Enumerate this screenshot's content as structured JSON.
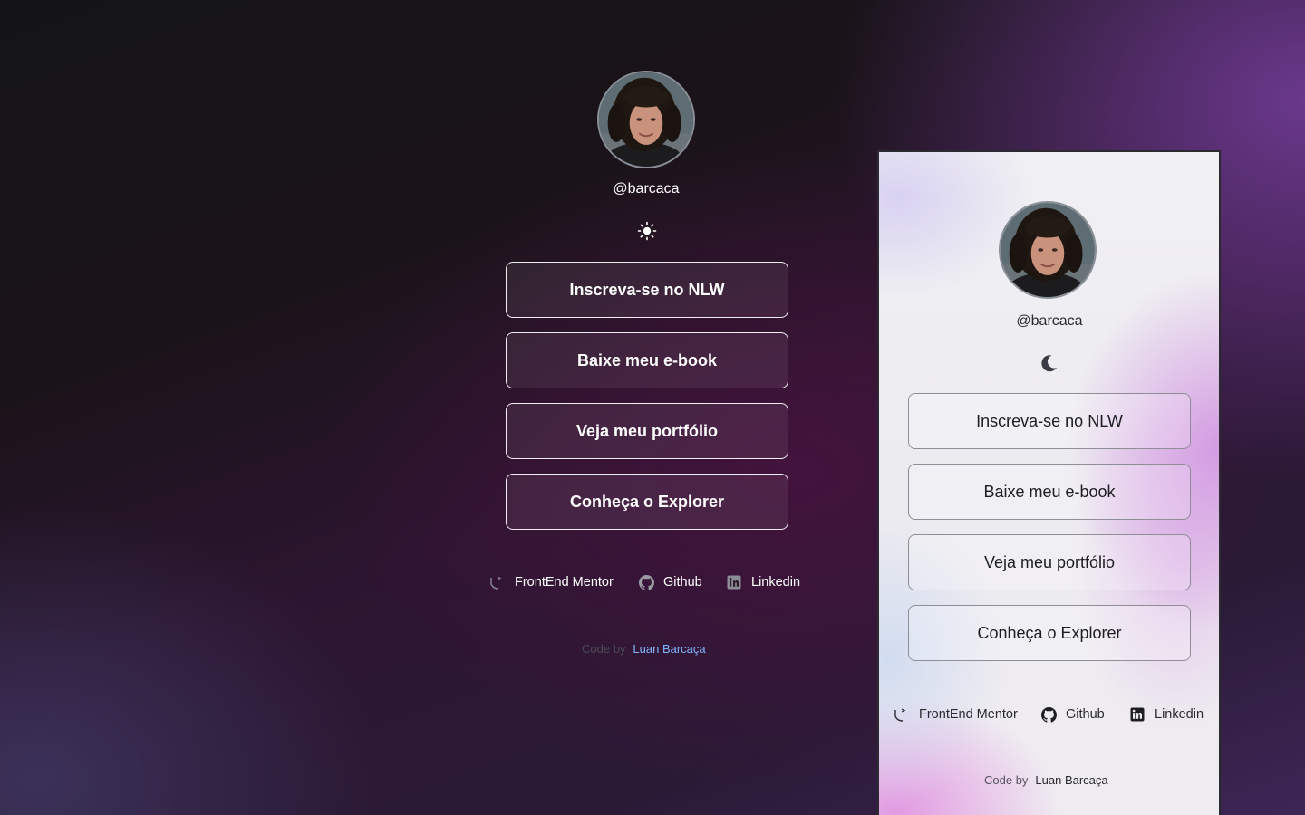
{
  "profile": {
    "handle": "@barcaca"
  },
  "links": [
    {
      "label": "Inscreva-se no NLW"
    },
    {
      "label": "Baixe meu e-book"
    },
    {
      "label": "Veja meu portfólio"
    },
    {
      "label": "Conheça o Explorer"
    }
  ],
  "social": [
    {
      "label": "FrontEnd Mentor",
      "icon": "frontend-mentor-icon"
    },
    {
      "label": "Github",
      "icon": "github-icon"
    },
    {
      "label": "Linkedin",
      "icon": "linkedin-icon"
    }
  ],
  "footer": {
    "prefix": "Code by",
    "author": "Luan Barcaça"
  },
  "theme": {
    "dark_toggle_icon": "sun-icon",
    "light_toggle_icon": "moon-icon",
    "accent_link_color": "#7fb5ff"
  }
}
